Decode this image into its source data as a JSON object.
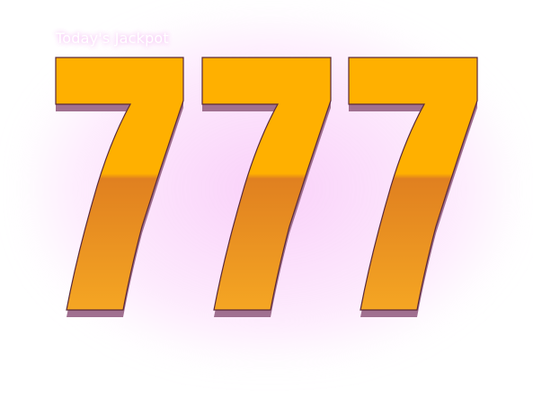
{
  "jackpot": {
    "caption": "Today's Jackpot",
    "digits": [
      "7",
      "7",
      "7"
    ],
    "colors": {
      "digit_fill_top": "#FFB000",
      "digit_fill_mid": "#E08020",
      "digit_fill_bottom": "#F5A623",
      "digit_outline": "#5a2a3a",
      "digit_shadow": "#a07090",
      "glow": "#F2A8F2",
      "caption_text": "#FFFFFF"
    }
  }
}
